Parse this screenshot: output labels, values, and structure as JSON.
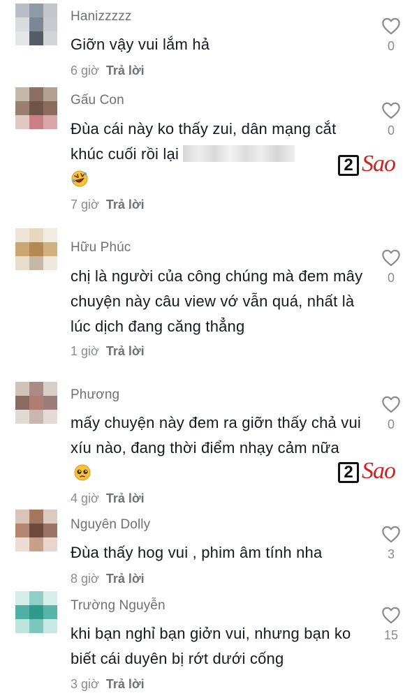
{
  "comments": [
    {
      "username": "Hanizzzzz",
      "text": "Giỡn vậy vui lắm hả",
      "time": "6 giờ",
      "reply": "Trả lời",
      "likes": "0",
      "avatar_colors": [
        "#b9bec6",
        "#8f9aa6",
        "#c3c7cc",
        "#d9dcdf",
        "#7d8793",
        "#c7cbcf",
        "#e3e5e7",
        "#555c66",
        "#d2d5d8"
      ]
    },
    {
      "username": "Gấu Con",
      "text": "Đùa cái này ko thấy zui, dân mạng cắt khúc cuối rồi lại",
      "time": "7 giờ",
      "reply": "Trả lời",
      "likes": "0",
      "avatar_colors": [
        "#c6b8a8",
        "#8a7060",
        "#b3a08e",
        "#9a7e70",
        "#6f5548",
        "#8c6c5c",
        "#e0c7c2",
        "#c97f86",
        "#dba6a8"
      ]
    },
    {
      "username": "Hữu Phúc",
      "text": "chị là người của công chúng mà đem mây chuyện này câu view vớ vẫn quá, nhất là lúc dịch đang căng thẳng",
      "time": "1 giờ",
      "reply": "Trả lời",
      "likes": "0",
      "avatar_colors": [
        "#efe5d6",
        "#e7d7bd",
        "#f2ebe0",
        "#c9a672",
        "#b48a52",
        "#d1b17e",
        "#e8dccb",
        "#c7b8a6",
        "#efe7db"
      ]
    },
    {
      "username": "Phương",
      "text": "mấy chuyện này đem ra giỡn thấy chả vui xíu nào, đang thời điểm nhạy cảm nữa",
      "time": "4 giờ",
      "reply": "Trả lời",
      "likes": "0",
      "avatar_colors": [
        "#d2c2bc",
        "#a98a84",
        "#d9cdc7",
        "#8c6a64",
        "#b07d72",
        "#9b7c78",
        "#e2d8d4",
        "#c8b6b2",
        "#e4dad6"
      ]
    },
    {
      "username": "Nguyên Dolly",
      "text": "Đùa thấy hog vui , phim âm tính nha",
      "time": "8 giờ",
      "reply": "Trả lời",
      "likes": "3",
      "avatar_colors": [
        "#d8c4b8",
        "#a17760",
        "#ddcabe",
        "#b48672",
        "#6d4a3a",
        "#9a7464",
        "#ecdcd2",
        "#c7a08c",
        "#e8d6cc"
      ]
    },
    {
      "username": "Trường Nguyễn",
      "text": "khi bạn nghỉ bạn giởn vui, nhưng bạn ko biết cái duyên bị rớt dưới cống",
      "time": "3 giờ",
      "reply": "Trả lời",
      "likes": "15",
      "avatar_colors": [
        "#d5ede9",
        "#8fcfc6",
        "#d8eeea",
        "#4fb0a3",
        "#2f9a8c",
        "#58b4a8",
        "#bfe3dd",
        "#7cc6bc",
        "#c9e8e3"
      ]
    }
  ],
  "watermark": {
    "number": "2",
    "brand": "Sao",
    "brand_color": "#d42020"
  },
  "icons": {
    "like": "heart-outline-icon",
    "emoji_laugh": "rolling-laughing-emoji-icon",
    "emoji_plead": "pleading-face-emoji-icon"
  }
}
